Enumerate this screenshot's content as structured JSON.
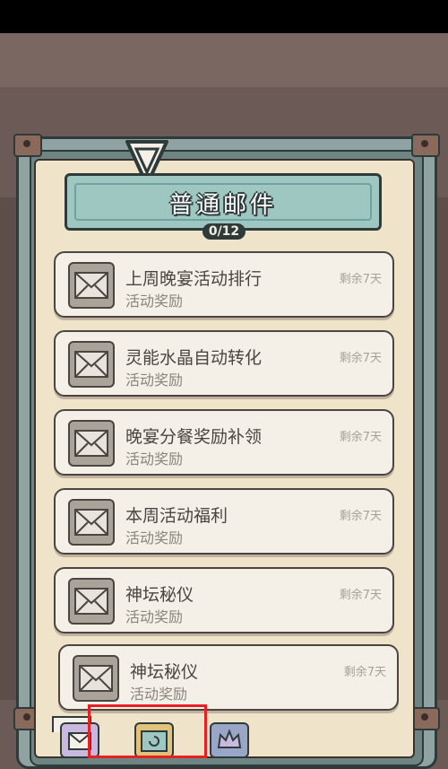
{
  "mailbox": {
    "title": "普通邮件",
    "counter": "0/12"
  },
  "mails": [
    {
      "title": "上周晚宴活动排行",
      "subtitle": "活动奖励",
      "remaining": "剩余7天"
    },
    {
      "title": "灵能水晶自动转化",
      "subtitle": "活动奖励",
      "remaining": "剩余7天"
    },
    {
      "title": "晚宴分餐奖励补领",
      "subtitle": "活动奖励",
      "remaining": "剩余7天"
    },
    {
      "title": "本周活动福利",
      "subtitle": "活动奖励",
      "remaining": "剩余7天"
    },
    {
      "title": "神坛秘仪",
      "subtitle": "活动奖励",
      "remaining": "剩余7天"
    },
    {
      "title": "神坛秘仪",
      "subtitle": "活动奖励",
      "remaining": "剩余7天"
    }
  ],
  "tabs": [
    {
      "icon": "mail-tab-icon"
    },
    {
      "icon": "swirl-tab-icon"
    },
    {
      "icon": "crown-tab-icon"
    }
  ],
  "colors": {
    "highlight": "#e62124",
    "banner": "#9ec7c1",
    "paper": "#efe4c9",
    "frame": "#8fa3a2"
  }
}
